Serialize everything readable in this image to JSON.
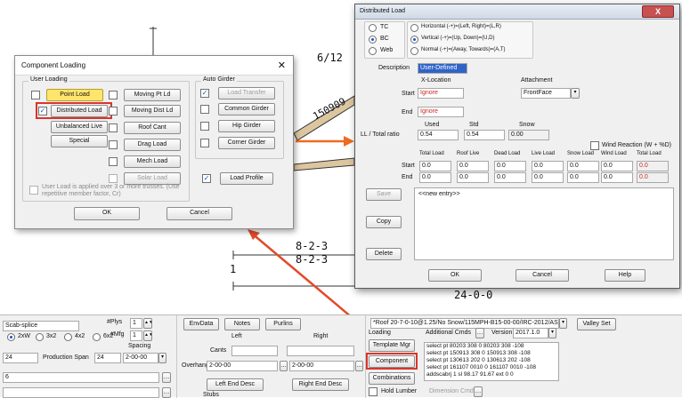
{
  "drawing": {
    "pitch": "6/12",
    "member_label_top": "150909",
    "dim_1": "8-2-3",
    "dim_2": "8-2-3",
    "ply_number": "1",
    "span_label": "24-0-0"
  },
  "component_dialog": {
    "title": "Component Loading",
    "user_loading_group": "User Loading",
    "auto_girder_group": "Auto Girder",
    "point_load": "Point Load",
    "distributed_load": "Distributed Load",
    "unbalanced_live": "Unbalanced Live",
    "special": "Special",
    "moving_pt_ld": "Moving Pt Ld",
    "moving_dist_ld": "Moving Dist Ld",
    "roof_cant": "Roof Cant",
    "drag_load": "Drag Load",
    "mech_load": "Mech Load",
    "solar_load": "Solar Load",
    "load_transfer": "Load Transfer",
    "common_girder": "Common Girder",
    "hip_girder": "Hip Girder",
    "corner_girder": "Corner Girder",
    "load_profile": "Load Profile",
    "note": "User Load is applied over 3 or more trusses. (Use repetitive member factor, Cr)",
    "ok": "OK",
    "cancel": "Cancel"
  },
  "dist_dialog": {
    "title": "Distributed Load",
    "close": "X",
    "radio_tc": "TC",
    "radio_bc": "BC",
    "radio_web": "Web",
    "dir_horizontal": "Horizontal (-+)=(Left, Right)=(L,R)",
    "dir_vertical": "Vertical (-+)=(Up, Down)=(U,D)",
    "dir_normal": "Normal (-+)=(Away, Towards)=(A,T)",
    "description_label": "Description",
    "description_value": "User-Defined",
    "x_location_label": "X-Location",
    "attachment_label": "Attachment",
    "start_label": "Start",
    "start_value": "Ignore",
    "attachment_value": "FrontFace",
    "end_label": "End",
    "end_value": "Ignore",
    "used_label": "Used",
    "std_label": "Std",
    "snow_label": "Snow",
    "ll_total_label": "LL / Total ratio",
    "ll_used": "0.54",
    "ll_std": "0.54",
    "ll_snow": "0.00",
    "wind_reaction": "Wind Reaction (W + %D)",
    "load_headers": [
      "Total Load",
      "Roof Live",
      "Dead Load",
      "Live Load",
      "Snow Load",
      "Wind Load",
      "Total Load"
    ],
    "start_row": [
      "0.0",
      "0.0",
      "0.0",
      "0.0",
      "0.0",
      "0.0",
      "0.0"
    ],
    "end_row": [
      "0.0",
      "0.0",
      "0.0",
      "0.0",
      "0.0",
      "0.0",
      "0.0"
    ],
    "save": "Save",
    "copy": "Copy",
    "delete": "Delete",
    "new_entry": "<<new entry>>",
    "ok": "OK",
    "cancel": "Cancel",
    "help": "Help"
  },
  "bottom": {
    "scab_splice": "Scab-splice",
    "plys_label": "#Plys",
    "plys_value": "1",
    "mfg_label": "#Mfg",
    "mfg_value": "1",
    "size_options": [
      "2xW",
      "3x2",
      "4x2",
      "6x2"
    ],
    "spacing_label": "Spacing",
    "span_left": "24",
    "production_span_label": "Production Span",
    "production_span_value": "24",
    "spacing_value": "2-00-00",
    "field_6": "6",
    "envdata": "EnvData",
    "notes": "Notes",
    "purlins": "Purlins",
    "left_label": "Left",
    "right_label": "Right",
    "cants_label": "Cants",
    "overhangs_label": "Overhangs",
    "overhang_left": "2-00-00",
    "overhang_right": "2-00-00",
    "left_end_desc": "Left End Desc",
    "right_end_desc": "Right End Desc",
    "stubs_label": "Stubs",
    "loading_desc": "*Roof 20-7-0-10@1.25/No Snow/115MPH-B15-00-00/IRC-2012/ASCE",
    "valley_set": "Valley Set",
    "loading_label": "Loading",
    "template_mgr": "Template Mgr",
    "component": "Component",
    "combinations": "Combinations",
    "additional_cmds": "Additional Cmds",
    "version_label": "Version",
    "version_value": "2017.1.0",
    "cmd_lines": [
      "select pt 80203 308 0  80203 308 -108",
      "select pt 150913 308 0  150913 308 -108",
      "select pt 130613 202 0  130613 202 -108",
      "select pt 161107 0010 0  161107 0010 -108",
      "addscabrj 1 sl 98.17 91.67 ext 0 0"
    ],
    "hold_lumber": "Hold Lumber",
    "dimension_cmds": "Dimension Cmds"
  }
}
